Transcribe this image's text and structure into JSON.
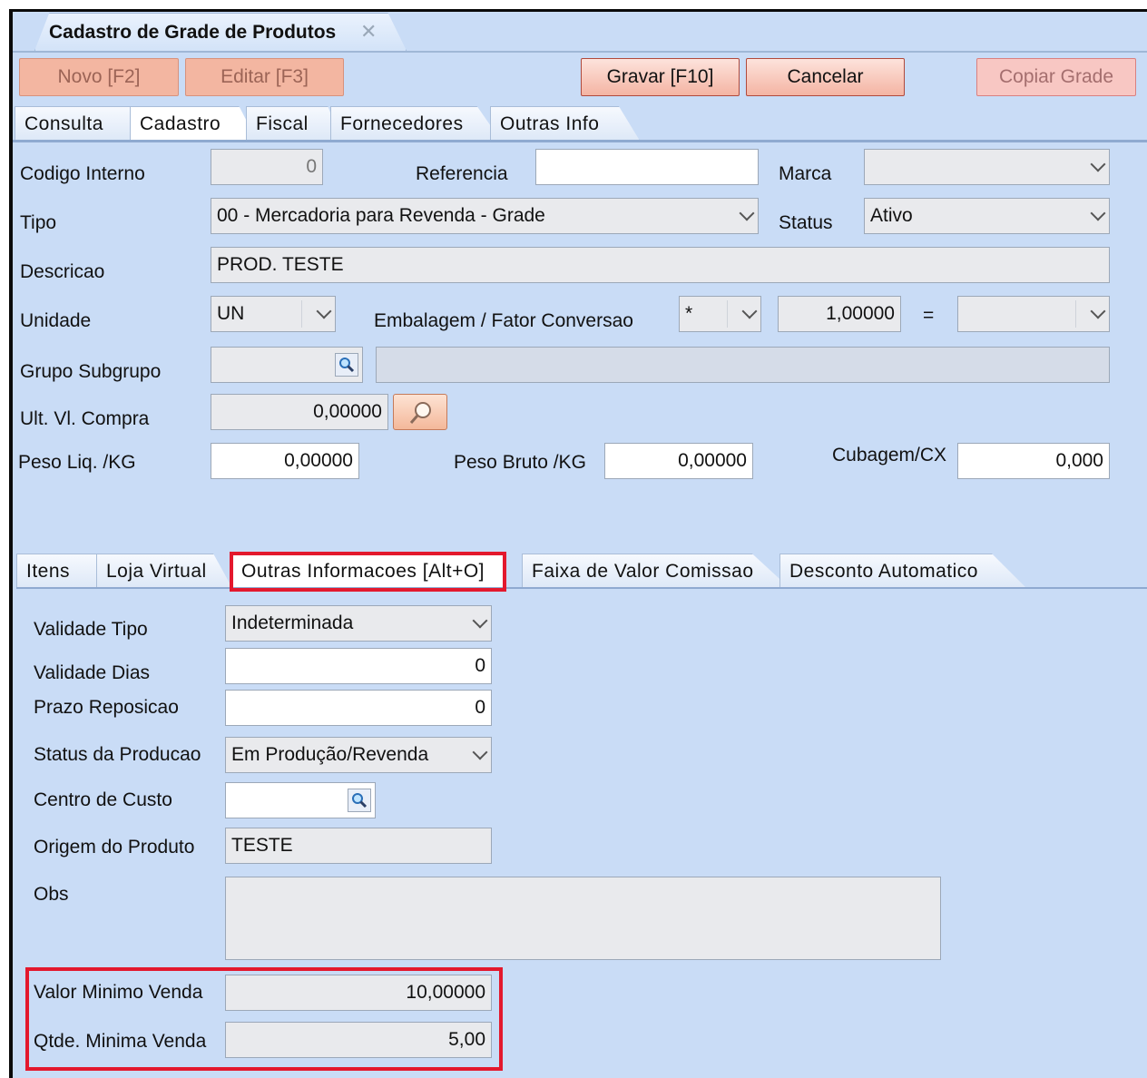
{
  "window": {
    "tab_title": "Cadastro de Grade de Produtos"
  },
  "toolbar": {
    "novo": "Novo [F2]",
    "editar": "Editar [F3]",
    "gravar": "Gravar [F10]",
    "cancelar": "Cancelar",
    "copiar": "Copiar Grade"
  },
  "main_tabs": [
    "Consulta",
    "Cadastro",
    "Fiscal",
    "Fornecedores",
    "Outras Info"
  ],
  "form": {
    "codigo_interno": {
      "label": "Codigo Interno",
      "value": "0"
    },
    "referencia": {
      "label": "Referencia",
      "value": ""
    },
    "marca": {
      "label": "Marca",
      "value": ""
    },
    "tipo": {
      "label": "Tipo",
      "value": "00 - Mercadoria para Revenda - Grade"
    },
    "status": {
      "label": "Status",
      "value": "Ativo"
    },
    "descricao": {
      "label": "Descricao",
      "value": "PROD. TESTE"
    },
    "unidade": {
      "label": "Unidade",
      "value": "UN"
    },
    "embalagem": {
      "label": "Embalagem / Fator Conversao",
      "operator": "*",
      "value": "1,00000",
      "equals": "=",
      "result": ""
    },
    "grupo_subgrupo": {
      "label": "Grupo Subgrupo",
      "value": "",
      "description": ""
    },
    "ult_vl_compra": {
      "label": "Ult. Vl. Compra",
      "value": "0,00000"
    },
    "peso_liq": {
      "label": "Peso Liq. /KG",
      "value": "0,00000"
    },
    "peso_bruto": {
      "label": "Peso Bruto /KG",
      "value": "0,00000"
    },
    "cubagem": {
      "label": "Cubagem/CX",
      "value": "0,000"
    }
  },
  "sub_tabs": [
    "Itens",
    "Loja Virtual",
    "Outras Informacoes [Alt+O]",
    "Faixa de Valor Comissao",
    "Desconto Automatico"
  ],
  "outras": {
    "validade_tipo": {
      "label": "Validade Tipo",
      "value": "Indeterminada"
    },
    "validade_dias": {
      "label": "Validade Dias",
      "value": "0"
    },
    "prazo_reposicao": {
      "label": "Prazo Reposicao",
      "value": "0"
    },
    "status_producao": {
      "label": "Status da Producao",
      "value": "Em Produção/Revenda"
    },
    "centro_custo": {
      "label": "Centro de Custo",
      "value": ""
    },
    "origem_produto": {
      "label": "Origem do Produto",
      "value": "TESTE"
    },
    "obs": {
      "label": "Obs",
      "value": ""
    },
    "valor_minimo_venda": {
      "label": "Valor Minimo Venda",
      "value": "10,00000"
    },
    "qtde_minima_venda": {
      "label": "Qtde. Minima Venda",
      "value": "5,00"
    }
  },
  "colors": {
    "background": "#c9dcf6",
    "highlight": "#e3182d",
    "button": "#f4b4a3"
  }
}
